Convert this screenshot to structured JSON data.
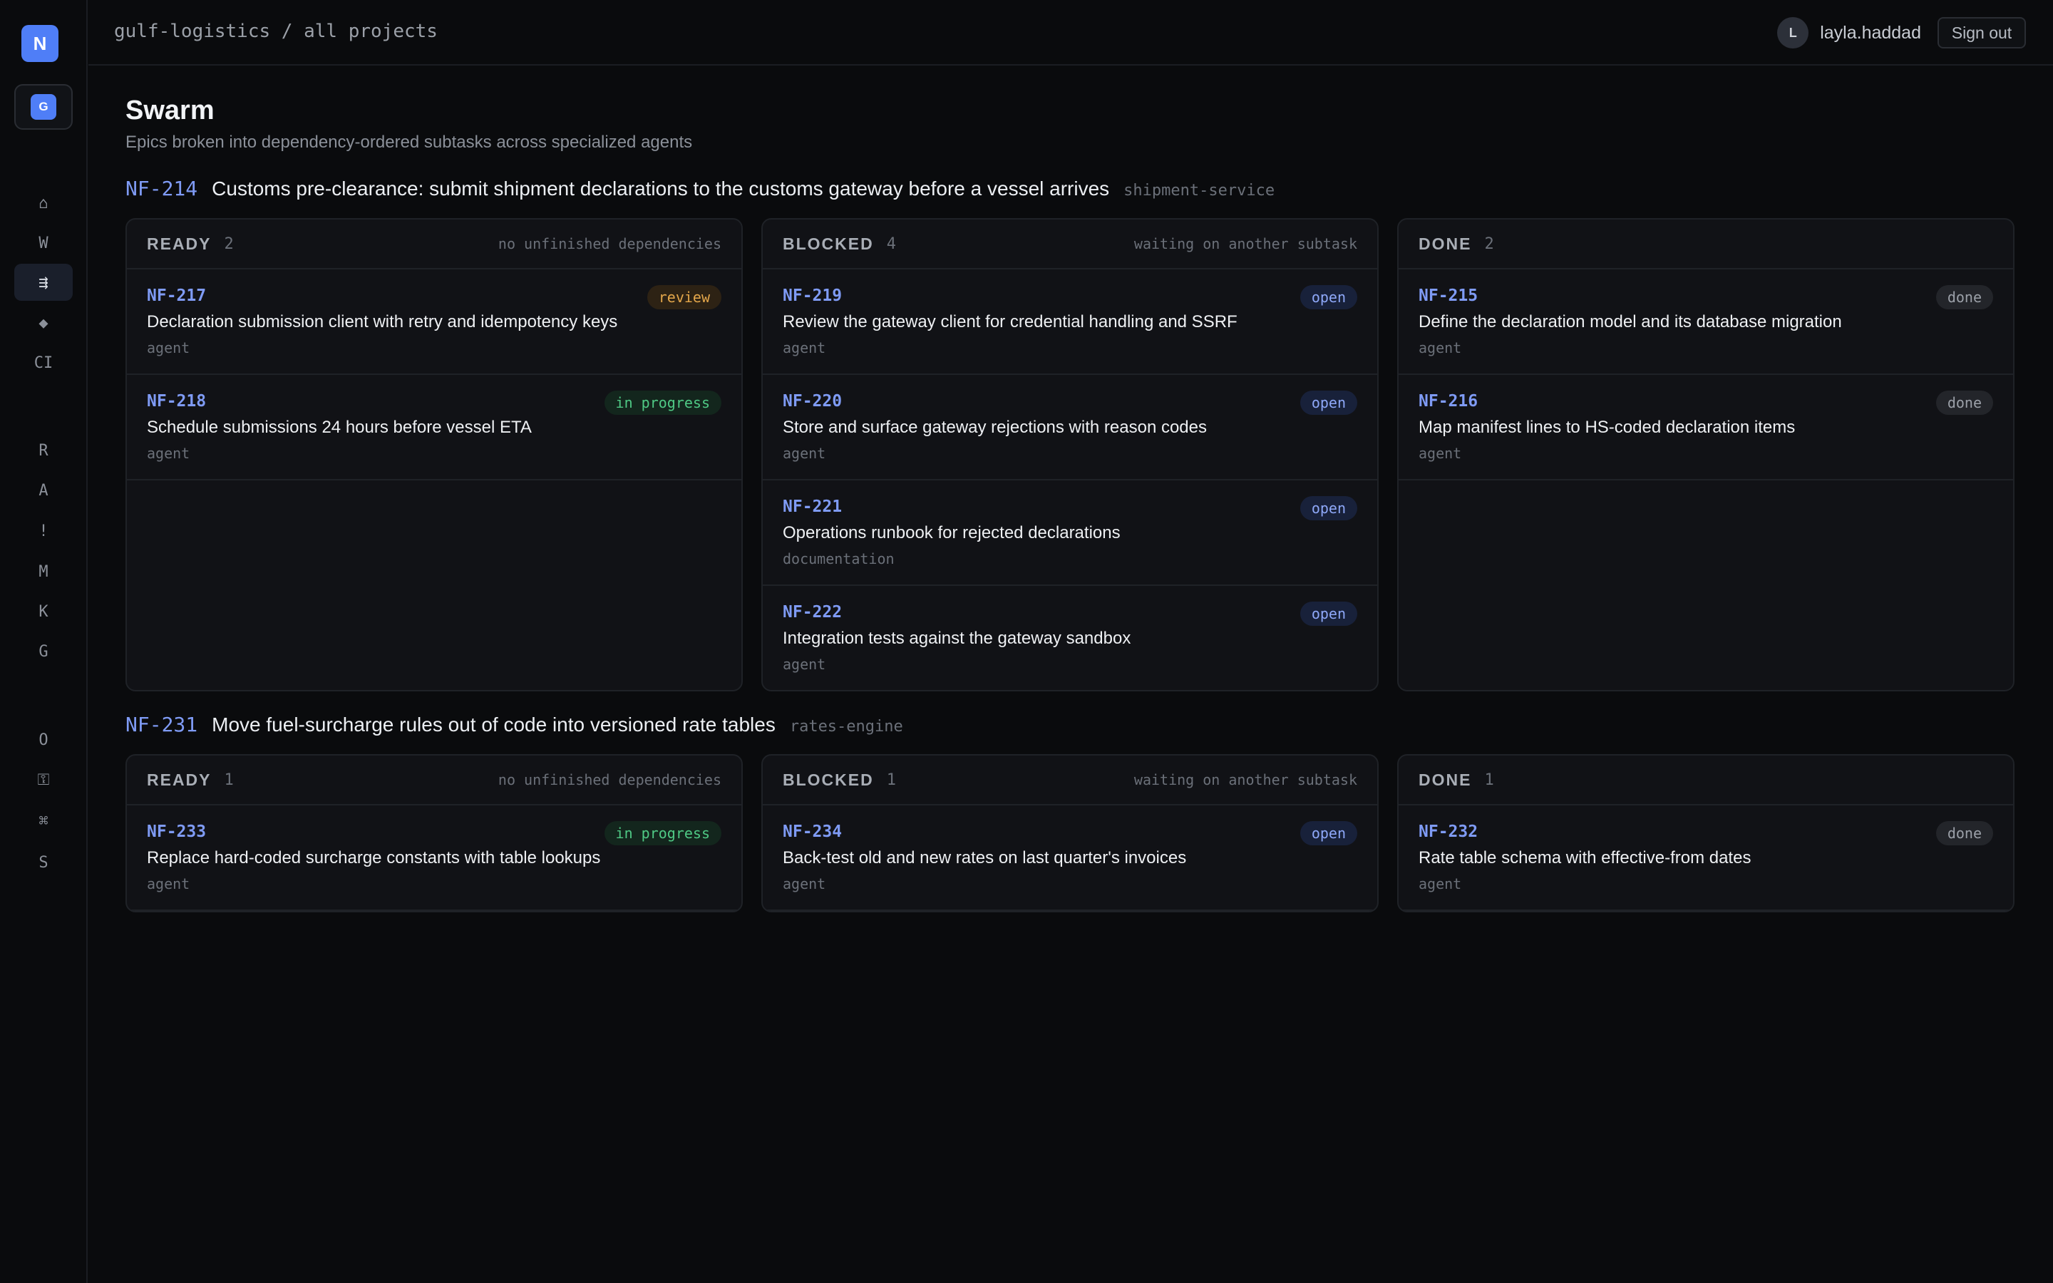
{
  "sidebar": {
    "logo": "N",
    "workspace_badge": "G",
    "nav_groups": [
      [
        "⌂",
        "W",
        "⇶",
        "◆",
        "CI"
      ],
      [
        "R",
        "A",
        "!",
        "M",
        "K",
        "G"
      ],
      [
        "O",
        "⚿",
        "⌘",
        "S"
      ]
    ]
  },
  "header": {
    "breadcrumb": "gulf-logistics / all projects",
    "user_initial": "L",
    "username": "layla.haddad",
    "signout_label": "Sign out"
  },
  "page": {
    "title": "Swarm",
    "subtitle": "Epics broken into dependency-ordered subtasks across specialized agents"
  },
  "epics": [
    {
      "id": "NF-214",
      "title": "Customs pre-clearance: submit shipment declarations to the customs gateway before a vessel arrives",
      "service": "shipment-service",
      "columns": [
        {
          "name": "READY",
          "count": "2",
          "hint": "no unfinished dependencies",
          "cards": [
            {
              "id": "NF-217",
              "title": "Declaration submission client with retry and idempotency keys",
              "role": "agent",
              "status": "review"
            },
            {
              "id": "NF-218",
              "title": "Schedule submissions 24 hours before vessel ETA",
              "role": "agent",
              "status": "in progress"
            }
          ]
        },
        {
          "name": "BLOCKED",
          "count": "4",
          "hint": "waiting on another subtask",
          "cards": [
            {
              "id": "NF-219",
              "title": "Review the gateway client for credential handling and SSRF",
              "role": "agent",
              "status": "open"
            },
            {
              "id": "NF-220",
              "title": "Store and surface gateway rejections with reason codes",
              "role": "agent",
              "status": "open"
            },
            {
              "id": "NF-221",
              "title": "Operations runbook for rejected declarations",
              "role": "documentation",
              "status": "open"
            },
            {
              "id": "NF-222",
              "title": "Integration tests against the gateway sandbox",
              "role": "agent",
              "status": "open"
            }
          ]
        },
        {
          "name": "DONE",
          "count": "2",
          "hint": "",
          "cards": [
            {
              "id": "NF-215",
              "title": "Define the declaration model and its database migration",
              "role": "agent",
              "status": "done"
            },
            {
              "id": "NF-216",
              "title": "Map manifest lines to HS-coded declaration items",
              "role": "agent",
              "status": "done"
            }
          ]
        }
      ]
    },
    {
      "id": "NF-231",
      "title": "Move fuel-surcharge rules out of code into versioned rate tables",
      "service": "rates-engine",
      "columns": [
        {
          "name": "READY",
          "count": "1",
          "hint": "no unfinished dependencies",
          "cards": [
            {
              "id": "NF-233",
              "title": "Replace hard-coded surcharge constants with table lookups",
              "role": "agent",
              "status": "in progress"
            }
          ]
        },
        {
          "name": "BLOCKED",
          "count": "1",
          "hint": "waiting on another subtask",
          "cards": [
            {
              "id": "NF-234",
              "title": "Back-test old and new rates on last quarter's invoices",
              "role": "agent",
              "status": "open"
            }
          ]
        },
        {
          "name": "DONE",
          "count": "1",
          "hint": "",
          "cards": [
            {
              "id": "NF-232",
              "title": "Rate table schema with effective-from dates",
              "role": "agent",
              "status": "done"
            }
          ]
        }
      ]
    }
  ]
}
